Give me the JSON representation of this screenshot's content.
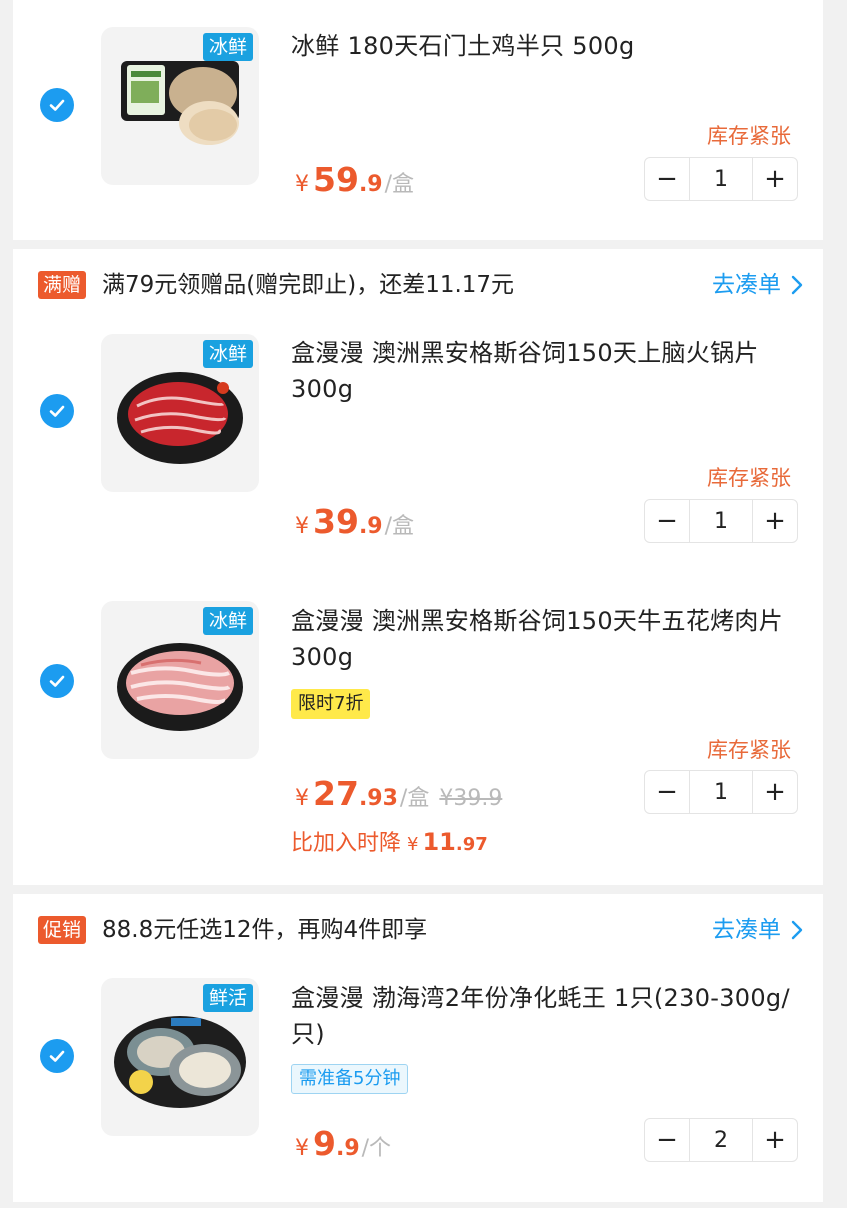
{
  "colors": {
    "accent": "#1c9cf0",
    "price": "#ec5a2d",
    "stock": "#e86a3a",
    "fresh_tag": "#1aa1e0",
    "discount_tag": "#ffe94a"
  },
  "items": [
    {
      "tag": "冰鲜",
      "title": "冰鲜 180天石门土鸡半只 500g",
      "stock": "库存紧张",
      "currency": "¥",
      "price_int": "59",
      "price_dec": ".9",
      "unit": "/盒",
      "qty": "1",
      "icons": {
        "minus": "minus-icon",
        "plus": "plus-icon",
        "check": "check-icon"
      }
    },
    {
      "tag": "冰鲜",
      "title": "盒漫漫 澳洲黑安格斯谷饲150天上脑火锅片300g",
      "stock": "库存紧张",
      "currency": "¥",
      "price_int": "39",
      "price_dec": ".9",
      "unit": "/盒",
      "qty": "1"
    },
    {
      "tag": "冰鲜",
      "title": "盒漫漫 澳洲黑安格斯谷饲150天牛五花烤肉片 300g",
      "discount_tag": "限时7折",
      "stock": "库存紧张",
      "currency": "¥",
      "price_int": "27",
      "price_dec": ".93",
      "unit": "/盒",
      "original_price": "¥39.9",
      "drop_label": "比加入时降",
      "drop_currency": "¥",
      "drop_int": "11",
      "drop_dec": ".97",
      "qty": "1"
    },
    {
      "tag": "鲜活",
      "title": "盒漫漫 渤海湾2年份净化蚝王 1只(230-300g/只)",
      "prep_tag": "需准备5分钟",
      "currency": "¥",
      "price_int": "9",
      "price_dec": ".9",
      "unit": "/个",
      "qty": "2"
    }
  ],
  "promos": [
    {
      "badge": "满赠",
      "text": "满79元领赠品(赠完即止)，还差11.17元",
      "link": "去凑单"
    },
    {
      "badge": "促销",
      "text": "88.8元任选12件，再购4件即享",
      "link": "去凑单"
    }
  ],
  "stepper": {
    "minus": "−",
    "plus": "+"
  }
}
